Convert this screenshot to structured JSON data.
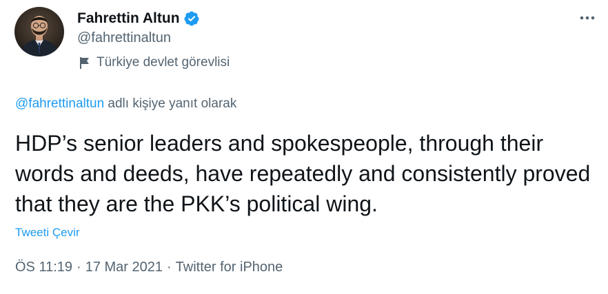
{
  "user": {
    "display_name": "Fahrettin Altun",
    "handle": "@fahrettinaltun",
    "label": "Türkiye devlet görevlisi",
    "verified_color": "#1d9bf0"
  },
  "reply": {
    "handle": "@fahrettinaltun",
    "suffix": " adlı kişiye yanıt olarak"
  },
  "tweet": {
    "text": "HDP’s senior leaders and spokespeople, through their words and deeds, have repeatedly and consistently proved that they are the PKK’s political wing.",
    "translate_label": "Tweeti Çevir"
  },
  "meta": {
    "time": "ÖS 11:19",
    "separator": "·",
    "date": "17 Mar 2021",
    "source": "Twitter for iPhone"
  },
  "icons": {
    "more": "more-horizontal-icon",
    "verified": "verified-badge-icon",
    "label": "flag-icon"
  },
  "colors": {
    "accent": "#1d9bf0",
    "secondary_text": "#536471",
    "primary_text": "#0f1419"
  }
}
